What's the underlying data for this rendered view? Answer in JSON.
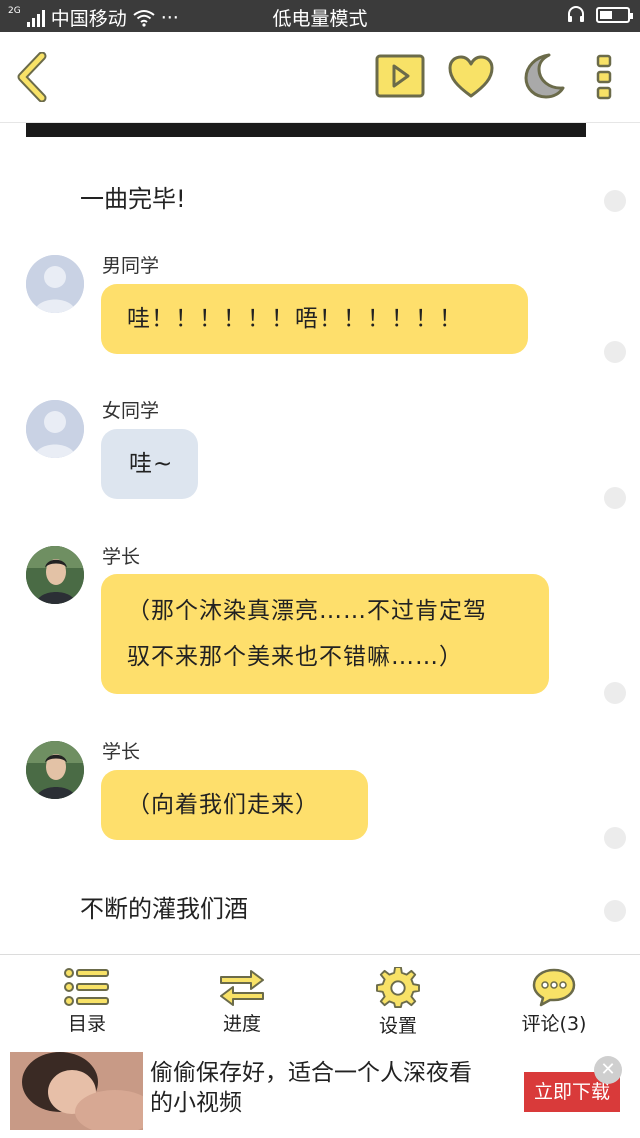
{
  "status_bar": {
    "signal_tag": "2G",
    "carrier": "中国移动",
    "more": "···",
    "mode": "低电量模式",
    "battery_level": 0.45
  },
  "toolbar": {
    "back_icon": "chevron-left-icon",
    "play_icon": "play-icon",
    "favorite_icon": "heart-icon",
    "night_icon": "moon-icon",
    "more_icon": "vertical-dots-icon"
  },
  "story": {
    "narration_1": "一曲完毕!",
    "messages": [
      {
        "speaker": "男同学",
        "text": "哇！！！！！！唔！！！！！！",
        "style": "yellow",
        "avatar": "placeholder"
      },
      {
        "speaker": "女同学",
        "text": "哇~",
        "style": "blue",
        "avatar": "placeholder"
      },
      {
        "speaker": "学长",
        "line1": "（那个沐染真漂亮……不过肯定驾",
        "line2": "驭不来那个美来也不错嘛……）",
        "style": "yellow",
        "avatar": "photo"
      },
      {
        "speaker": "学长",
        "text": "（向着我们走来）",
        "style": "yellow",
        "avatar": "photo"
      }
    ],
    "narration_2": "不断的灌我们酒"
  },
  "bottom_nav": {
    "items": [
      {
        "label": "目录",
        "icon": "list-icon"
      },
      {
        "label": "进度",
        "icon": "swap-arrows-icon"
      },
      {
        "label": "设置",
        "icon": "gear-icon"
      },
      {
        "label": "评论(3)",
        "icon": "comment-icon"
      }
    ]
  },
  "ad": {
    "line1": "偷偷保存好，适合一个人深夜看",
    "line2": "的小视频",
    "button": "立即下载",
    "close": "✕"
  },
  "colors": {
    "accent_yellow": "#fedf6c",
    "bubble_blue": "#dde5ef",
    "icon_yellow": "#f8e267",
    "icon_stroke": "#6b6b4a",
    "ad_button": "#d93a3a"
  }
}
